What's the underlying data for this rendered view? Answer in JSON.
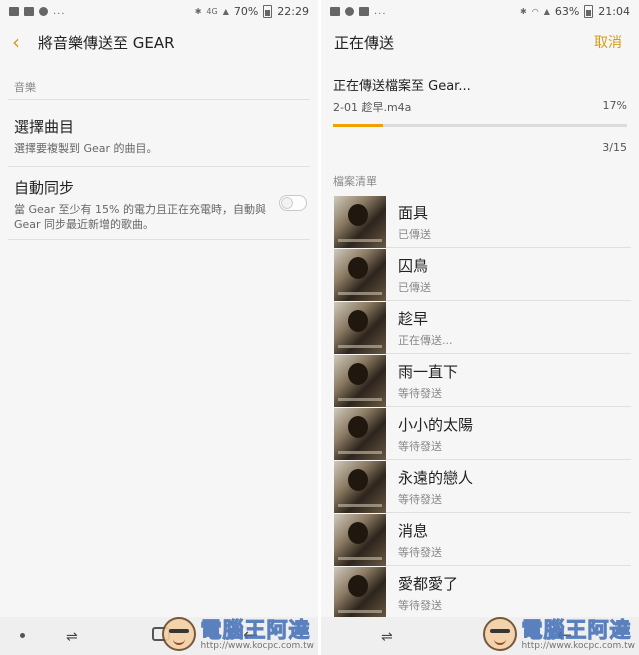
{
  "left": {
    "status": {
      "dots": "...",
      "network": "4G",
      "battery": "70%",
      "time": "22:29"
    },
    "header": {
      "title": "將音樂傳送至 GEAR"
    },
    "section_header": "音樂",
    "pref_select": {
      "title": "選擇曲目",
      "subtitle": "選擇要複製到 Gear 的曲目。"
    },
    "pref_autosync": {
      "title": "自動同步",
      "subtitle": "當 Gear 至少有 15% 的電力且正在充電時，自動與 Gear 同步最近新增的歌曲。",
      "enabled": false
    }
  },
  "right": {
    "status": {
      "dots": "...",
      "battery": "63%",
      "time": "21:04"
    },
    "header": {
      "title": "正在傳送",
      "cancel_label": "取消"
    },
    "transfer": {
      "title": "正在傳送檔案至 Gear...",
      "file": "2-01 趁早.m4a",
      "percent_text": "17%",
      "progress": 0.17,
      "counter": "3/15"
    },
    "list_header": "檔案清單",
    "files": [
      {
        "name": "面具",
        "status": "已傳送"
      },
      {
        "name": "囚鳥",
        "status": "已傳送"
      },
      {
        "name": "趁早",
        "status": "正在傳送..."
      },
      {
        "name": "雨一直下",
        "status": "等待發送"
      },
      {
        "name": "小小的太陽",
        "status": "等待發送"
      },
      {
        "name": "永遠的戀人",
        "status": "等待發送"
      },
      {
        "name": "消息",
        "status": "等待發送"
      },
      {
        "name": "愛都愛了",
        "status": "等待發送"
      }
    ]
  },
  "watermark": {
    "brand": "電腦王阿達",
    "url": "http://www.kocpc.com.tw"
  },
  "colors": {
    "accent": "#d99a1a",
    "progress": "#f0a000",
    "background": "#f6f6f6"
  }
}
